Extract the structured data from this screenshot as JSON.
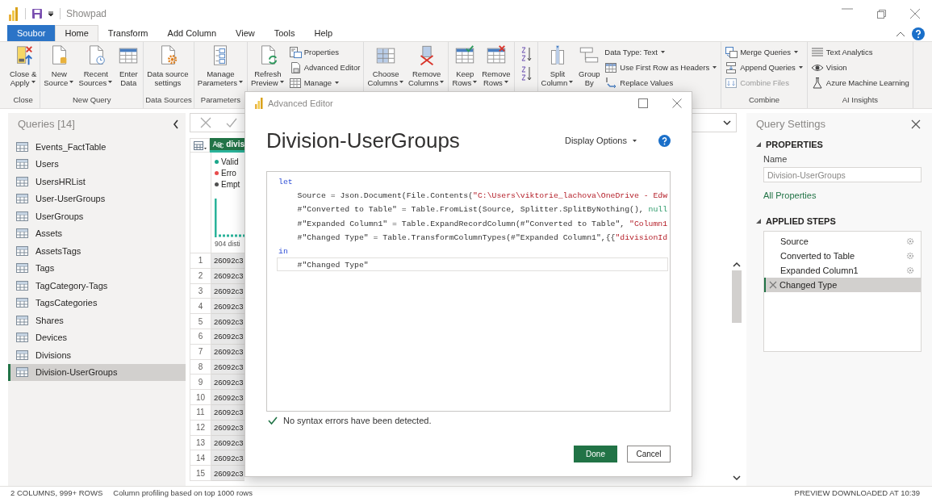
{
  "window": {
    "title": "Showpad"
  },
  "tabs": [
    {
      "label": "Soubor",
      "kind": "file",
      "selected": false
    },
    {
      "label": "Home",
      "kind": "tab",
      "selected": true
    },
    {
      "label": "Transform",
      "kind": "tab",
      "selected": false
    },
    {
      "label": "Add Column",
      "kind": "tab",
      "selected": false
    },
    {
      "label": "View",
      "kind": "tab",
      "selected": false
    },
    {
      "label": "Tools",
      "kind": "tab",
      "selected": false
    },
    {
      "label": "Help",
      "kind": "tab",
      "selected": false
    }
  ],
  "ribbon": {
    "groups": [
      {
        "kind": "buttons",
        "label": "Close",
        "large": [
          {
            "lines": [
              "Close &",
              "Apply"
            ],
            "dropdown": true
          }
        ]
      },
      {
        "kind": "buttons",
        "label": "New Query",
        "large": [
          {
            "lines": [
              "New",
              "Source"
            ],
            "dropdown": true
          },
          {
            "lines": [
              "Recent",
              "Sources"
            ],
            "dropdown": true
          },
          {
            "lines": [
              "Enter",
              "Data"
            ],
            "dropdown": false
          }
        ]
      },
      {
        "kind": "buttons",
        "label": "Data Sources",
        "large": [
          {
            "lines": [
              "Data source",
              "settings"
            ],
            "dropdown": false
          }
        ]
      },
      {
        "kind": "buttons",
        "label": "Parameters",
        "large": [
          {
            "lines": [
              "Manage",
              "Parameters"
            ],
            "dropdown": true
          }
        ]
      },
      {
        "kind": "buttons",
        "large": [
          {
            "lines": [
              "Refresh",
              "Preview"
            ],
            "dropdown": true
          }
        ],
        "small": [
          {
            "label": "Properties",
            "dropdown": false,
            "disabled": false
          },
          {
            "label": "Advanced Editor",
            "dropdown": false,
            "disabled": false
          },
          {
            "label": "Manage",
            "dropdown": true,
            "disabled": false
          }
        ]
      },
      {
        "kind": "buttons",
        "large": [
          {
            "lines": [
              "Choose",
              "Columns"
            ],
            "dropdown": true
          },
          {
            "lines": [
              "Remove",
              "Columns"
            ],
            "dropdown": true
          }
        ]
      },
      {
        "kind": "buttons",
        "large": [
          {
            "lines": [
              "Keep",
              "Rows"
            ],
            "dropdown": true
          },
          {
            "lines": [
              "Remove",
              "Rows"
            ],
            "dropdown": true
          }
        ]
      },
      {
        "kind": "sort"
      },
      {
        "kind": "buttons",
        "large": [
          {
            "lines": [
              "Split",
              "Column"
            ],
            "dropdown": true
          },
          {
            "lines": [
              "Group",
              "By"
            ],
            "dropdown": false
          }
        ],
        "small": [
          {
            "label": "Data Type: Text",
            "dropdown": true,
            "disabled": false
          },
          {
            "label": "Use First Row as Headers",
            "dropdown": true,
            "disabled": false
          },
          {
            "label": "Replace Values",
            "dropdown": false,
            "disabled": false
          }
        ]
      },
      {
        "kind": "buttons",
        "label": "Combine",
        "small": [
          {
            "label": "Merge Queries",
            "dropdown": true,
            "disabled": false
          },
          {
            "label": "Append Queries",
            "dropdown": true,
            "disabled": false
          },
          {
            "label": "Combine Files",
            "dropdown": false,
            "disabled": true
          }
        ]
      },
      {
        "kind": "buttons",
        "label": "AI Insights",
        "small": [
          {
            "label": "Text Analytics",
            "dropdown": false,
            "disabled": false
          },
          {
            "label": "Vision",
            "dropdown": false,
            "disabled": false
          },
          {
            "label": "Azure Machine Learning",
            "dropdown": false,
            "disabled": false
          }
        ]
      }
    ]
  },
  "queries": {
    "title": "Queries [14]",
    "items": [
      {
        "label": "Events_FactTable",
        "selected": false
      },
      {
        "label": "Users",
        "selected": false
      },
      {
        "label": "UsersHRList",
        "selected": false
      },
      {
        "label": "User-UserGroups",
        "selected": false
      },
      {
        "label": "UserGroups",
        "selected": false
      },
      {
        "label": "Assets",
        "selected": false
      },
      {
        "label": "AssetsTags",
        "selected": false
      },
      {
        "label": "Tags",
        "selected": false
      },
      {
        "label": "TagCategory-Tags",
        "selected": false
      },
      {
        "label": "TagsCategories",
        "selected": false
      },
      {
        "label": "Shares",
        "selected": false
      },
      {
        "label": "Devices",
        "selected": false
      },
      {
        "label": "Divisions",
        "selected": false
      },
      {
        "label": "Division-UserGroups",
        "selected": true
      }
    ]
  },
  "grid": {
    "column_header": "divis",
    "profile": [
      {
        "label": "Valid",
        "color": "#1aa68a"
      },
      {
        "label": "Erro",
        "color": "#e84c4c"
      },
      {
        "label": "Empt",
        "color": "#505050"
      }
    ],
    "distinct": "904 disti",
    "rows": [
      {
        "number": "1",
        "value": "26092c3"
      },
      {
        "number": "2",
        "value": "26092c3"
      },
      {
        "number": "3",
        "value": "26092c3"
      },
      {
        "number": "4",
        "value": "26092c3"
      },
      {
        "number": "5",
        "value": "26092c3"
      },
      {
        "number": "6",
        "value": "26092c3"
      },
      {
        "number": "7",
        "value": "26092c3"
      },
      {
        "number": "8",
        "value": "26092c3"
      },
      {
        "number": "9",
        "value": "26092c3"
      },
      {
        "number": "10",
        "value": "26092c3"
      },
      {
        "number": "11",
        "value": "26092c3"
      },
      {
        "number": "12",
        "value": "26092c3"
      },
      {
        "number": "13",
        "value": "26092c3"
      },
      {
        "number": "14",
        "value": "26092c3"
      },
      {
        "number": "15",
        "value": "26092c3"
      }
    ]
  },
  "advanced_editor": {
    "title": "Advanced Editor",
    "heading": "Division-UserGroups",
    "display_options": "Display Options",
    "code": [
      {
        "current": false,
        "tokens": [
          {
            "kind": "keyword",
            "text": "let"
          }
        ]
      },
      {
        "current": false,
        "tokens": [
          {
            "kind": "plain",
            "text": "    Source = Json.Document(File.Contents("
          },
          {
            "kind": "string",
            "text": "\"C:\\Users\\viktorie_lachova\\OneDrive - Edw"
          }
        ]
      },
      {
        "current": false,
        "tokens": [
          {
            "kind": "plain",
            "text": "    #\"Converted to Table\" = Table.FromList(Source, Splitter.SplitByNothing(), "
          },
          {
            "kind": "literal",
            "text": "null"
          }
        ]
      },
      {
        "current": false,
        "tokens": [
          {
            "kind": "plain",
            "text": "    #\"Expanded Column1\" = Table.ExpandRecordColumn(#\"Converted to Table\", "
          },
          {
            "kind": "string",
            "text": "\"Column1"
          }
        ]
      },
      {
        "current": false,
        "tokens": [
          {
            "kind": "plain",
            "text": "    #\"Changed Type\" = Table.TransformColumnTypes(#\"Expanded Column1\",{{"
          },
          {
            "kind": "string",
            "text": "\"divisionId"
          }
        ]
      },
      {
        "current": false,
        "tokens": [
          {
            "kind": "keyword",
            "text": "in"
          }
        ]
      },
      {
        "current": true,
        "tokens": [
          {
            "kind": "plain",
            "text": "    #\"Changed Type\""
          }
        ]
      }
    ],
    "status": "No syntax errors have been detected.",
    "buttons": [
      {
        "label": "Done",
        "kind": "primary"
      },
      {
        "label": "Cancel",
        "kind": "secondary"
      }
    ]
  },
  "query_settings": {
    "title": "Query Settings",
    "properties_heading": "PROPERTIES",
    "name_label": "Name",
    "name_value": "Division-UserGroups",
    "all_properties": "All Properties",
    "steps_heading": "APPLIED STEPS",
    "steps": [
      {
        "label": "Source",
        "selected": false,
        "settings": true
      },
      {
        "label": "Converted to Table",
        "selected": false,
        "settings": true
      },
      {
        "label": "Expanded Column1",
        "selected": false,
        "settings": true
      },
      {
        "label": "Changed Type",
        "selected": true,
        "settings": false
      }
    ]
  },
  "status_bar": {
    "left": [
      "2 COLUMNS, 999+ ROWS",
      "Column profiling based on top 1000 rows"
    ],
    "right": "PREVIEW DOWNLOADED AT 10:39"
  }
}
